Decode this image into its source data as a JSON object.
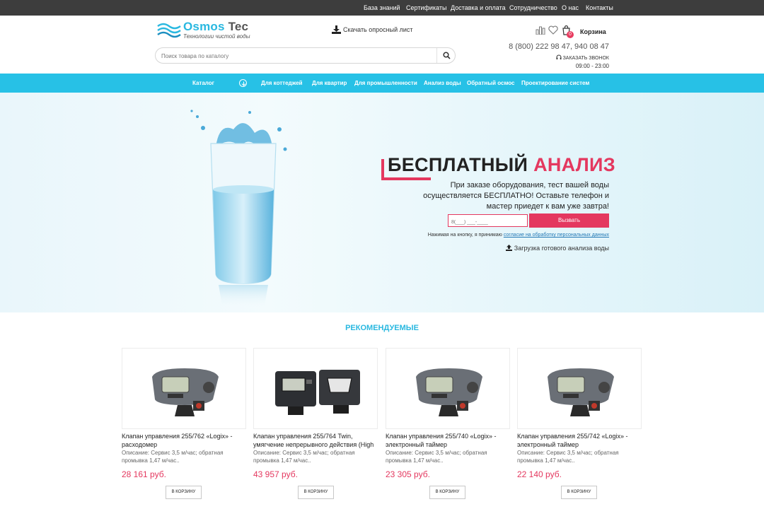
{
  "topbar": {
    "links": [
      "База знаний",
      "Сертификаты",
      "Доставка и оплата",
      "Сотрудничество",
      "О нас",
      "Контакты"
    ]
  },
  "header": {
    "logo_name_part1": "Osmos",
    "logo_name_part2": "Tec",
    "logo_tagline": "Технологии чистой воды",
    "download_label": "Скачать опросный лист",
    "search_placeholder": "Поиск товара по каталогу",
    "cart_count": "0",
    "cart_label": "Корзина",
    "phone": "8 (800) 222 98 47, 940 08 47",
    "callback": "Заказать звонок",
    "hours": "09:00 - 23:00"
  },
  "nav": {
    "catalog": "Каталог",
    "items": [
      "Для коттеджей",
      "Для квартир",
      "Для промышленности",
      "Анализ воды",
      "Обратный осмос",
      "Проектирование систем"
    ]
  },
  "hero": {
    "title_part1": "БЕСПЛАТНЫЙ",
    "title_part2": "АНАЛИЗ",
    "text": "При заказе оборудования, тест вашей воды осуществляется БЕСПЛАТНО! Оставьте телефон и мастер приедет к вам уже завтра!",
    "phone_placeholder": "8(___) ___-____",
    "call_button": "Вызвать",
    "consent_text": "Нажимая на кнопку, я принимаю",
    "consent_link": "согласие на обработку персональных данных",
    "upload_label": "Загрузка готового анализа воды"
  },
  "recommended": {
    "title": "РЕКОМЕНДУЕМЫЕ",
    "products": [
      {
        "name": "Клапан управления 255/762 «Logix» - расходомер",
        "desc": "Описание: Сервис 3,5 м/час; обратная промывка 1,47 м/час..",
        "price": "28 161 руб.",
        "button": "В КОРЗИНУ"
      },
      {
        "name": "Клапан управления 255/764 Twin, умягчение непрерывного действия (High",
        "desc": "Описание: Сервис 3,5 м/час; обратная промывка 1,47 м/час..",
        "price": "43 957 руб.",
        "button": "В КОРЗИНУ"
      },
      {
        "name": "Клапан управления 255/740 «Logix» - электронный таймер",
        "desc": "Описание: Сервис 3,5 м/час; обратная промывка 1,47 м/час..",
        "price": "23 305 руб.",
        "button": "В КОРЗИНУ"
      },
      {
        "name": "Клапан управления 255/742 «Logix» - электронный таймер",
        "desc": "Описание: Сервис 3,5 м/час; обратная промывка 1,47 м/час..",
        "price": "22 140 руб.",
        "button": "В КОРЗИНУ"
      }
    ]
  },
  "colors": {
    "accent_blue": "#27c1e6",
    "accent_red": "#e4385f",
    "topbar": "#3d3d3d"
  }
}
